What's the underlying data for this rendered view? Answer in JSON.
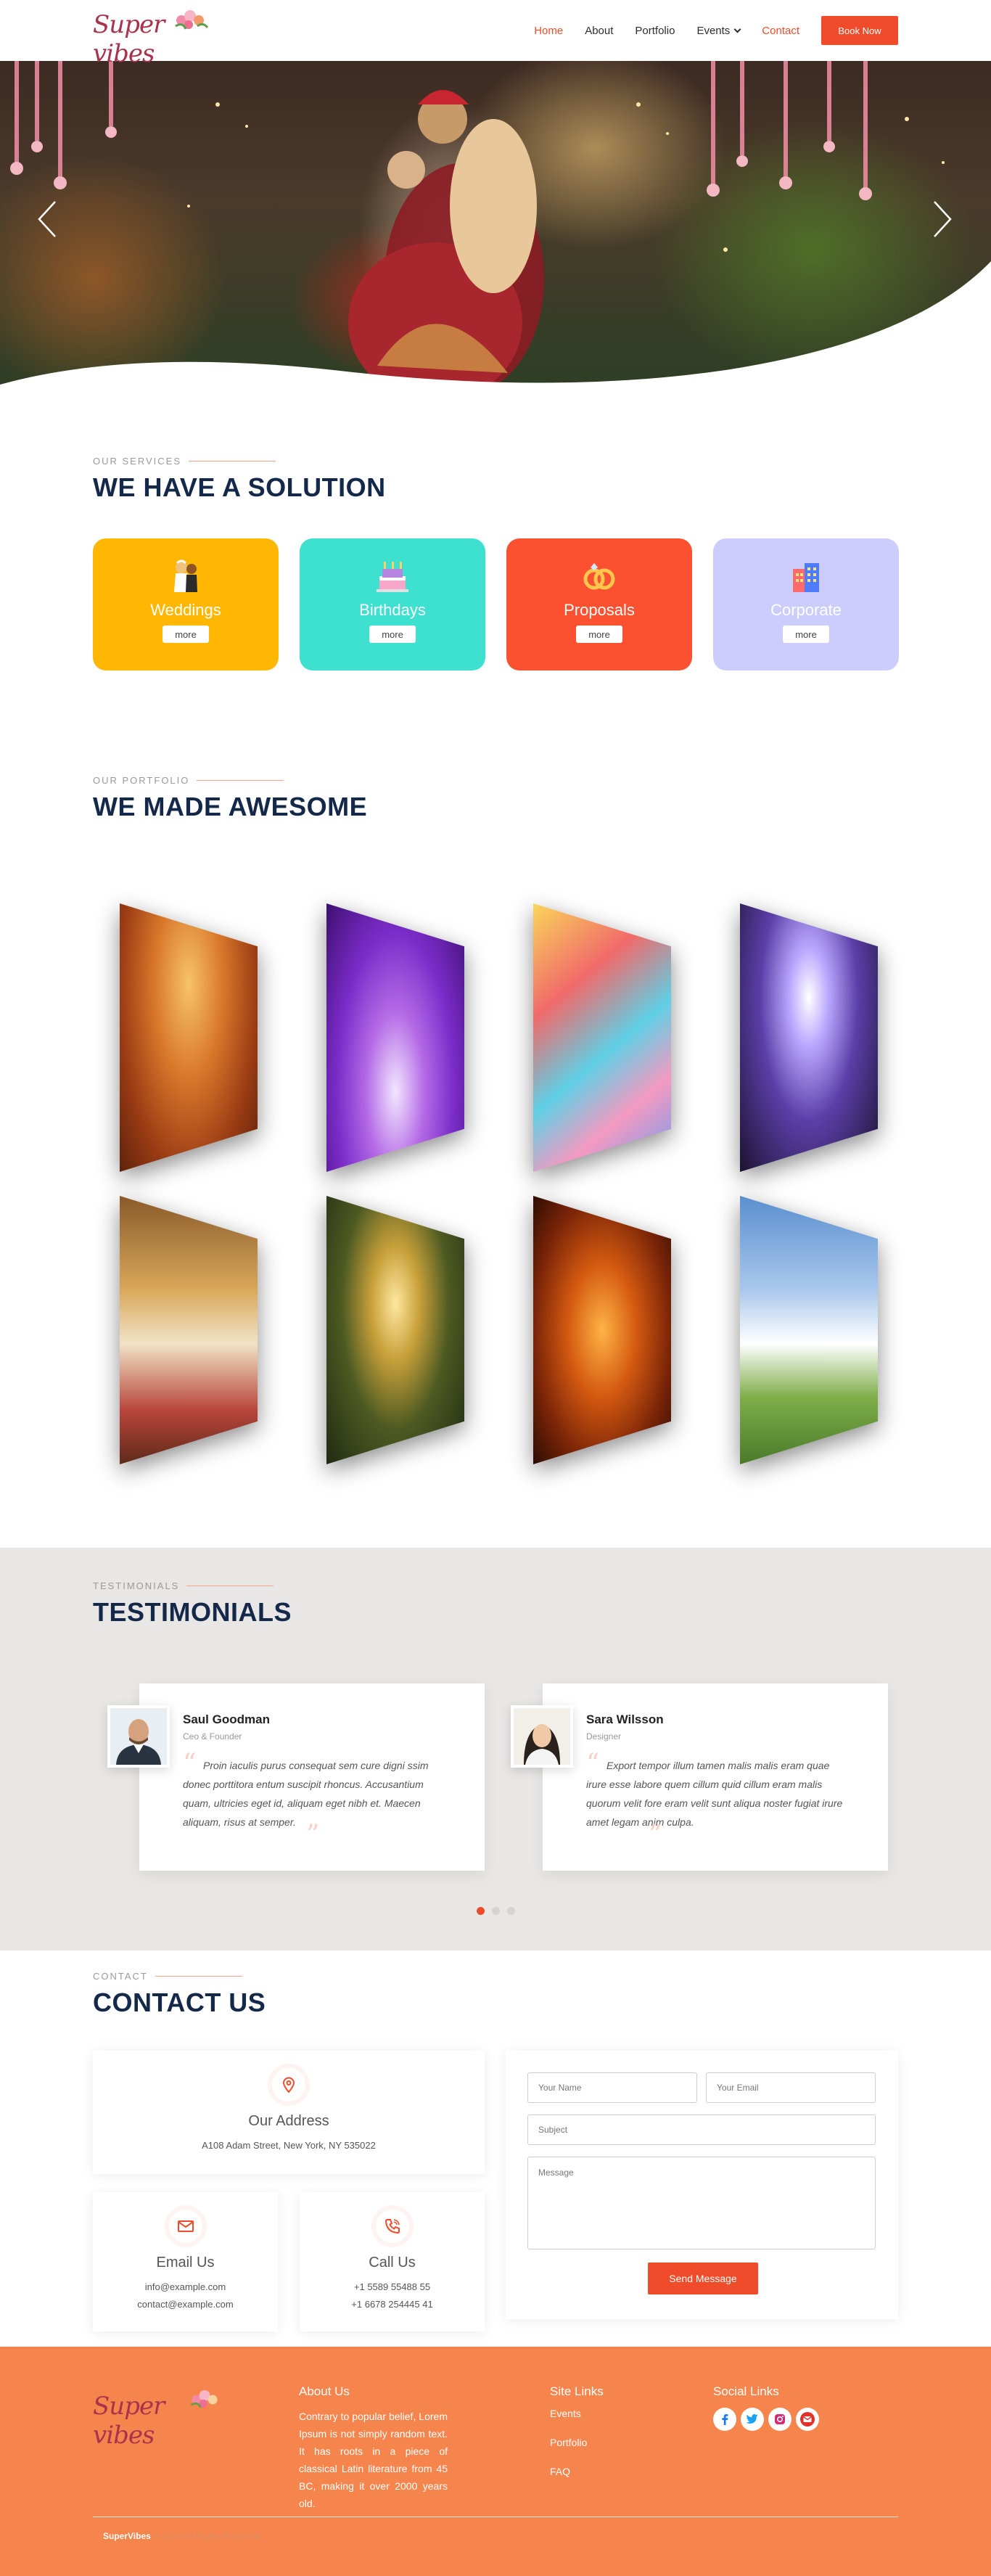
{
  "header": {
    "logo_text": "Super vibes",
    "nav": [
      "Home",
      "About",
      "Portfolio",
      "Events",
      "Contact"
    ],
    "book_label": "Book Now"
  },
  "services": {
    "eyebrow": "OUR SERVICES",
    "title": "WE HAVE A SOLUTION",
    "more_label": "more",
    "items": [
      {
        "label": "Weddings",
        "color": "#ffb703"
      },
      {
        "label": "Birthdays",
        "color": "#3ee0cf"
      },
      {
        "label": "Proposals",
        "color": "#fc5130"
      },
      {
        "label": "Corporate",
        "color": "#cccdfd"
      }
    ]
  },
  "portfolio": {
    "eyebrow": "OUR PORTFOLIO",
    "title": "WE MADE AWESOME"
  },
  "testimonials": {
    "eyebrow": "TESTIMONIALS",
    "title": "TESTIMONIALS",
    "items": [
      {
        "name": "Saul Goodman",
        "role": "Ceo & Founder",
        "quote": "Proin iaculis purus consequat sem cure digni ssim donec porttitora entum suscipit rhoncus. Accusantium quam, ultricies eget id, aliquam eget nibh et. Maecen aliquam, risus at semper."
      },
      {
        "name": "Sara Wilsson",
        "role": "Designer",
        "quote": "Export tempor illum tamen malis malis eram quae irure esse labore quem cillum quid cillum eram malis quorum velit fore eram velit sunt aliqua noster fugiat irure amet legam anim culpa."
      }
    ]
  },
  "contact": {
    "eyebrow": "CONTACT",
    "title": "CONTACT US",
    "address_title": "Our Address",
    "address": "A108 Adam Street, New York, NY 535022",
    "email_title": "Email Us",
    "email_1": "info@example.com",
    "email_2": "contact@example.com",
    "call_title": "Call Us",
    "phone_1": "+1 5589 55488 55",
    "phone_2": "+1 6678 254445 41",
    "form": {
      "name_placeholder": "Your Name",
      "email_placeholder": "Your Email",
      "subject_placeholder": "Subject",
      "message_placeholder": "Message",
      "send_label": "Send Message"
    }
  },
  "footer": {
    "logo_text": "Super vibes",
    "about_title": "About Us",
    "about_text": "Contrary to popular belief, Lorem Ipsum is not simply random text. It has roots in a piece of classical Latin literature from 45 BC, making it over 2000 years old.",
    "links_title": "Site Links",
    "links": [
      "Events",
      "Portfolio",
      "FAQ"
    ],
    "social_title": "Social Links",
    "brand": "SuperVibes",
    "copyright": "© 2020 All Rights Reserved"
  }
}
